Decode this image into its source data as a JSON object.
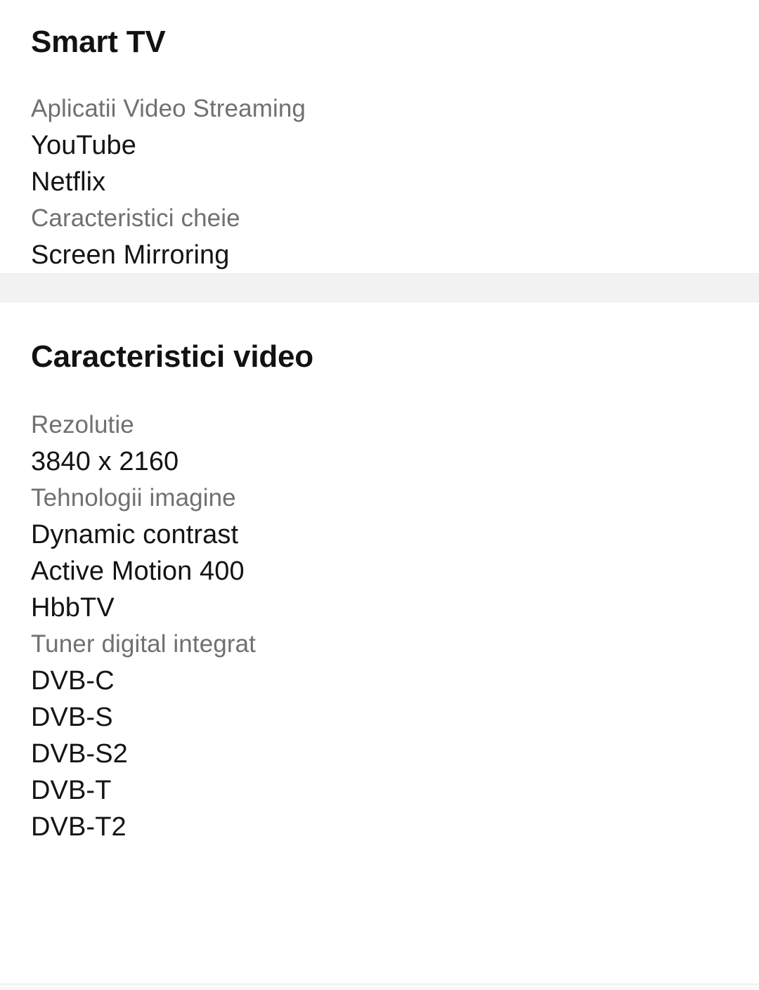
{
  "sections": [
    {
      "title": "Smart TV",
      "groups": [
        {
          "label": "Aplicatii Video Streaming",
          "values": [
            "YouTube",
            "Netflix"
          ]
        },
        {
          "label": "Caracteristici cheie",
          "values": [
            "Screen Mirroring"
          ]
        }
      ]
    },
    {
      "title": "Caracteristici video",
      "groups": [
        {
          "label": "Rezolutie",
          "values": [
            "3840 x 2160"
          ]
        },
        {
          "label": "Tehnologii imagine",
          "values": [
            "Dynamic contrast",
            "Active Motion 400",
            "HbbTV"
          ]
        },
        {
          "label": "Tuner digital integrat",
          "values": [
            "DVB-C",
            "DVB-S",
            "DVB-S2",
            "DVB-T",
            "DVB-T2"
          ]
        }
      ]
    }
  ],
  "colors": {
    "label": "#70706f",
    "value": "#141414",
    "title": "#121212",
    "separator_band": "#f2f2f3",
    "background": "#ffffff"
  }
}
